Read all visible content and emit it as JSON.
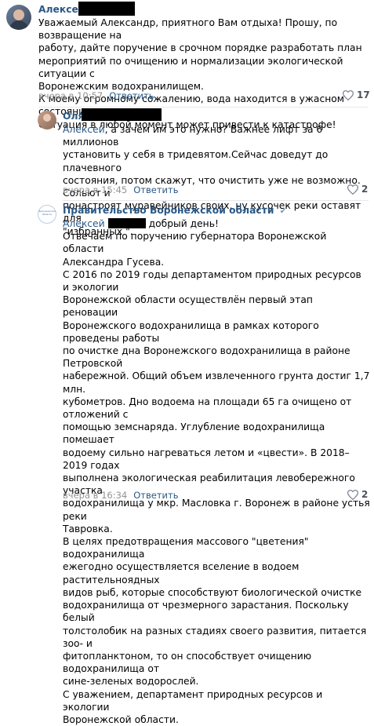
{
  "comments": [
    {
      "author": "Алексей",
      "text": "Уважаемый Александр, приятного Вам отдыха! Прошу, по возвращение на\nработу, дайте поручение в срочном порядке разработать план\nмероприятий по очищению и нормализации экологической ситуации с\nВоронежским водохранилищем.\nК моему огромному сожалению, вода находится в ужасном состоянии.\nСитуация в любой момент может привести к катастрофе!",
      "time": "вчера в 10:57",
      "reply": "Ответить",
      "likes": "17"
    },
    {
      "author": "Оля",
      "mention": "Алексей",
      "text": ", а зачем им это нужно? Важнее лифт за 6 миллионов\nустановить у себя в тридевятом.Сейчас доведут до плачевного\nсостояния, потом скажут, что очистить уже не возможно. Сольют и\nпонастроят муравейников своих, ну кусочек реки оставят для\n\"избранных \".",
      "time": "вчера в 15:45",
      "reply": "Ответить",
      "likes": "2"
    },
    {
      "author": "Правительство Воронежской области",
      "verified": "✔",
      "avatar_caption": "Воронежская область",
      "mention": "Алексей",
      "mention_tail": "добрый день!",
      "text": "Отвечаем по поручению губернатора Воронежской области\nАлександра Гусева.\nС 2016 по 2019 годы департаментом природных ресурсов и экологии\nВоронежской области осуществлён первый этап реновации\nВоронежского водохранилища в рамках которого проведены работы\nпо очистке дна Воронежского водохранилища в районе Петровской\nнабережной. Общий объем извлеченного грунта достиг 1,7 млн.\nкубометров. Дно водоема на площади 65 га очищено от отложений с\nпомощью земснаряда. Углубление водохранилища помешает\nводоему сильно нагреваться летом и «цвести». В 2018–2019 годах\nвыполнена экологическая реабилитация левобережного участка\nводохранилища у мкр. Масловка г. Воронеж в районе устья реки\nТавровка.\nВ целях предотвращения массового \"цветения\" водохранилища\nежегодно осуществляется вселение в водоем растительноядных\nвидов рыб, которые способствуют биологической очистке\nводохранилища от чрезмерного зарастания. Поскольку белый\nтолстолобик на разных стадиях своего развития, питается зоо- и\nфитопланктоном, то он способствует очищению водохранилища от\nсине-зеленых водорослей.\nС уважением, департамент природных ресурсов и экологии\nВоронежской области.",
      "time": "вчера в 16:34",
      "reply": "Ответить",
      "likes": "2"
    }
  ],
  "colors": {
    "link": "#2a5885",
    "meta": "#939393",
    "separator": "#e7e8ec"
  }
}
